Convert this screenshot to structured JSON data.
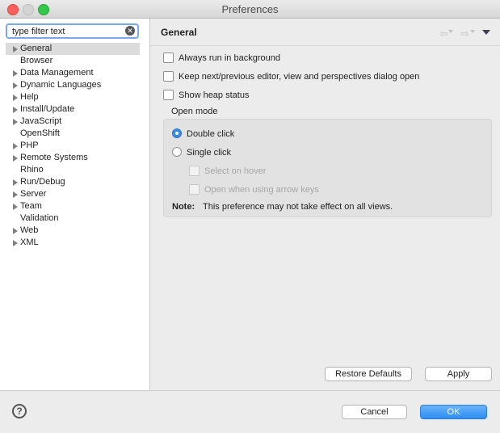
{
  "window": {
    "title": "Preferences"
  },
  "filter": {
    "value": "type filter text",
    "clear_glyph": "✕"
  },
  "tree": {
    "items": [
      {
        "label": "General",
        "expandable": true,
        "selected": true
      },
      {
        "label": "Browser",
        "expandable": false
      },
      {
        "label": "Data Management",
        "expandable": true
      },
      {
        "label": "Dynamic Languages",
        "expandable": true
      },
      {
        "label": "Help",
        "expandable": true
      },
      {
        "label": "Install/Update",
        "expandable": true
      },
      {
        "label": "JavaScript",
        "expandable": true
      },
      {
        "label": "OpenShift",
        "expandable": false
      },
      {
        "label": "PHP",
        "expandable": true
      },
      {
        "label": "Remote Systems",
        "expandable": true
      },
      {
        "label": "Rhino",
        "expandable": false
      },
      {
        "label": "Run/Debug",
        "expandable": true
      },
      {
        "label": "Server",
        "expandable": true
      },
      {
        "label": "Team",
        "expandable": true
      },
      {
        "label": "Validation",
        "expandable": false
      },
      {
        "label": "Web",
        "expandable": true
      },
      {
        "label": "XML",
        "expandable": true
      }
    ]
  },
  "page": {
    "title": "General",
    "nav": {
      "back_glyph": "⇦",
      "forward_glyph": "⇨"
    },
    "always_run_background": "Always run in background",
    "keep_next_prev": "Keep next/previous editor, view and perspectives dialog open",
    "show_heap": "Show heap status",
    "open_mode": {
      "label": "Open mode",
      "double_click": "Double click",
      "single_click": "Single click",
      "select_on_hover": "Select on hover",
      "open_arrow_keys": "Open when using arrow keys",
      "note_label": "Note:",
      "note_text": "This preference may not take effect on all views."
    },
    "restore_defaults": "Restore Defaults",
    "apply": "Apply"
  },
  "footer": {
    "help_glyph": "?",
    "cancel": "Cancel",
    "ok": "OK"
  },
  "colors": {
    "accent": "#3b8de3",
    "selection": "#dcdcdc"
  }
}
